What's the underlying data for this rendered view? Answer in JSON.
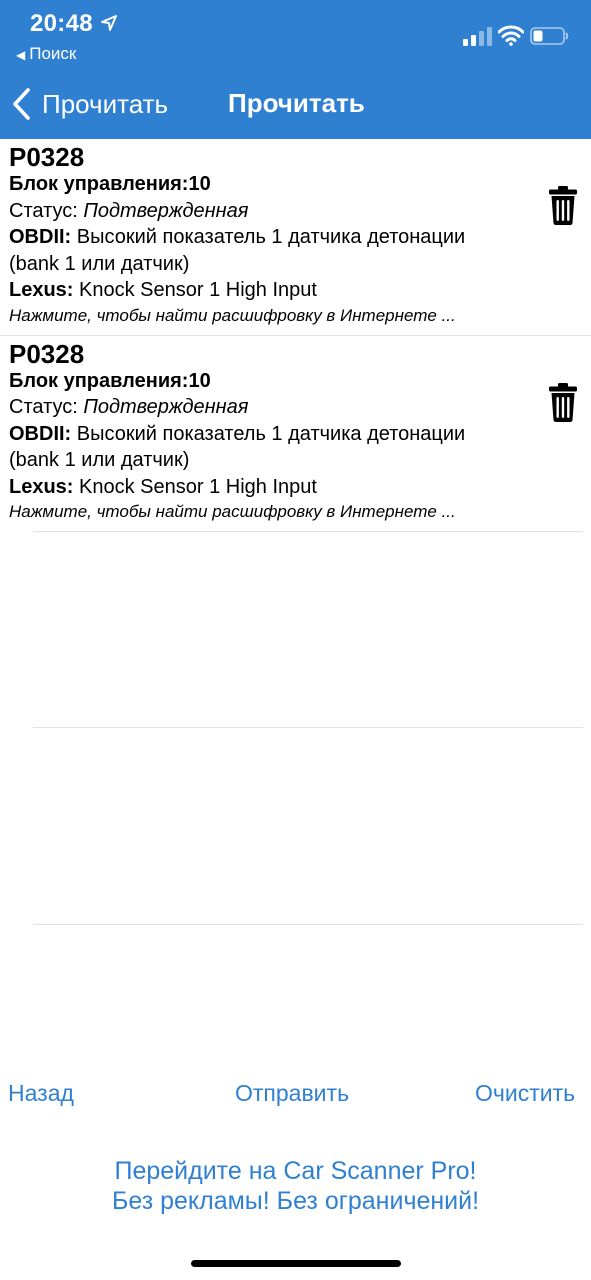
{
  "status_bar": {
    "time": "20:48",
    "back_app": "Поиск"
  },
  "nav": {
    "back_label": "Прочитать",
    "title": "Прочитать"
  },
  "codes": [
    {
      "code": "P0328",
      "block_label": "Блок управления:10",
      "status_label": "Статус: ",
      "status_value": "Подтвержденная",
      "obd_label": "OBDII:",
      "obd_text": " Высокий показатель 1 датчика детонации",
      "obd_text2": "(bank 1 или датчик)",
      "make_label": "Lexus:",
      "make_text": " Knock Sensor 1 High Input",
      "hint": "Нажмите, чтобы найти расшифровку в Интернете ..."
    },
    {
      "code": "P0328",
      "block_label": "Блок управления:10",
      "status_label": "Статус: ",
      "status_value": "Подтвержденная",
      "obd_label": "OBDII:",
      "obd_text": " Высокий показатель 1 датчика детонации",
      "obd_text2": "(bank 1 или датчик)",
      "make_label": "Lexus:",
      "make_text": " Knock Sensor 1 High Input",
      "hint": "Нажмите, чтобы найти расшифровку в Интернете ..."
    }
  ],
  "actions": {
    "back": "Назад",
    "send": "Отправить",
    "clear": "Очистить"
  },
  "promo": {
    "line1": "Перейдите на Car Scanner Pro!",
    "line2": "Без рекламы! Без ограничений!"
  },
  "colors": {
    "accent": "#2f80d1",
    "separator": "#e1e1e5"
  }
}
